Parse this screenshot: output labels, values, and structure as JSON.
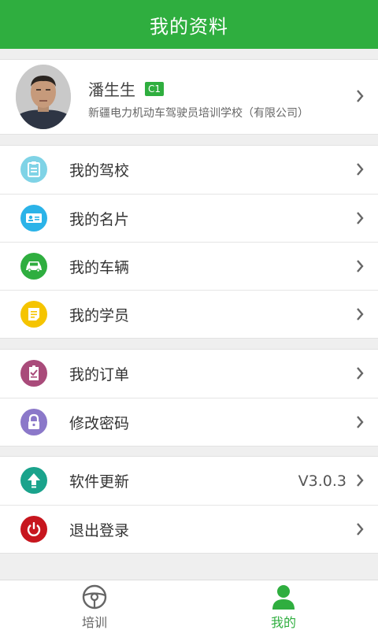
{
  "header": {
    "title": "我的资料"
  },
  "profile": {
    "name": "潘生生",
    "license_badge": "C1",
    "school": "新疆电力机动车驾驶员培训学校（有限公司）"
  },
  "menu_groups": [
    [
      {
        "label": "我的驾校",
        "icon": "clipboard-icon",
        "color": "#7fd3e6"
      },
      {
        "label": "我的名片",
        "icon": "id-card-icon",
        "color": "#2bb3e8"
      },
      {
        "label": "我的车辆",
        "icon": "car-icon",
        "color": "#2fae3f"
      },
      {
        "label": "我的学员",
        "icon": "notes-icon",
        "color": "#f5c400"
      }
    ],
    [
      {
        "label": "我的订单",
        "icon": "order-icon",
        "color": "#a94b7a"
      },
      {
        "label": "修改密码",
        "icon": "lock-icon",
        "color": "#8b78c9"
      }
    ],
    [
      {
        "label": "软件更新",
        "icon": "upload-arrow-icon",
        "color": "#1aa38c",
        "value": "V3.0.3"
      },
      {
        "label": "退出登录",
        "icon": "power-icon",
        "color": "#c7161e"
      }
    ]
  ],
  "tabbar": {
    "tabs": [
      {
        "label": "培训",
        "icon": "steering-wheel-icon",
        "active": false
      },
      {
        "label": "我的",
        "icon": "person-icon",
        "active": true
      }
    ],
    "active_color": "#2fae3f",
    "inactive_color": "#666666"
  }
}
